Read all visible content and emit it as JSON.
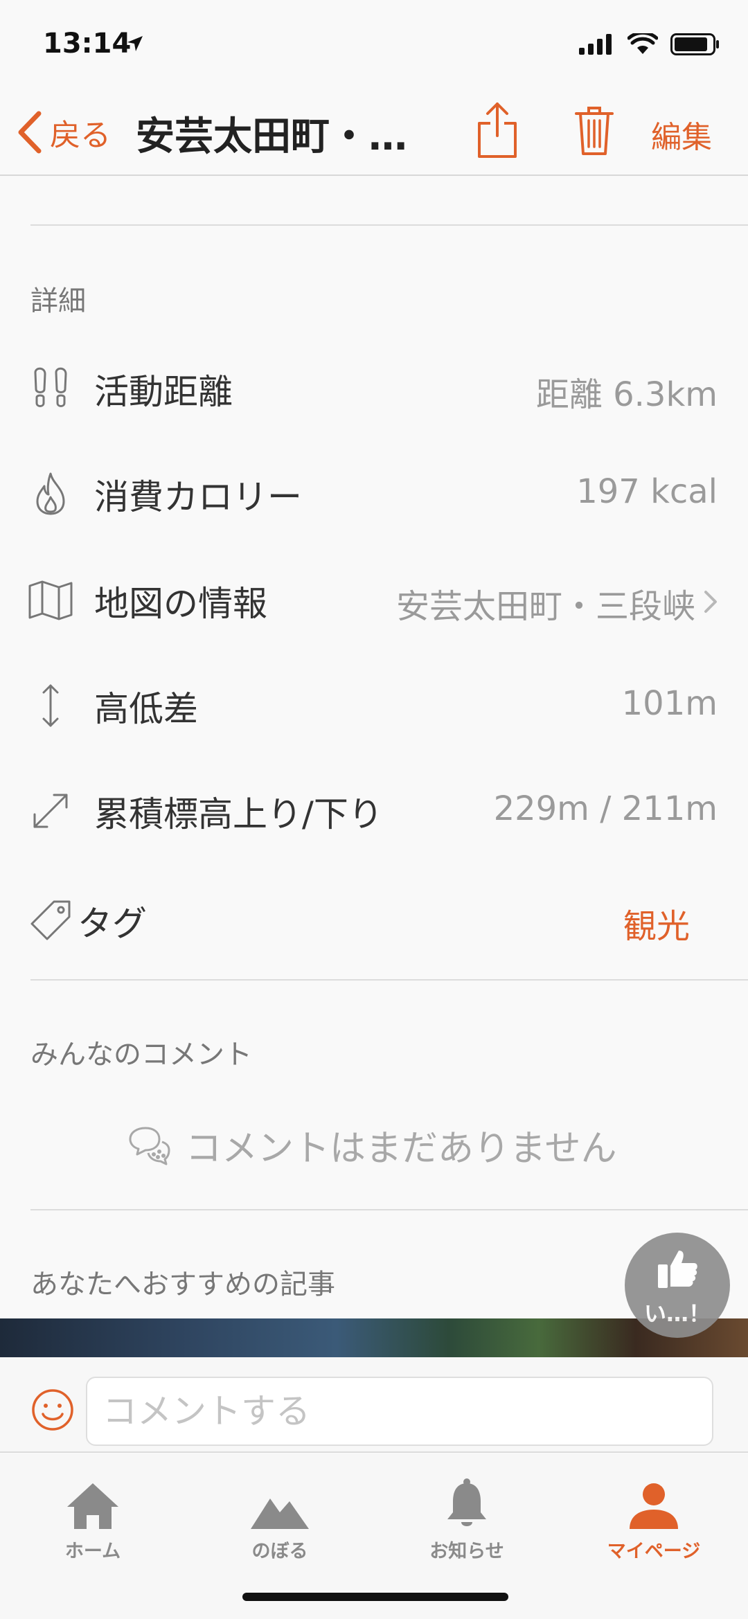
{
  "status_bar": {
    "time": "13:14"
  },
  "nav": {
    "back_label": "戻る",
    "title": "安芸太田町・…",
    "edit_label": "編集"
  },
  "details": {
    "section_title": "詳細",
    "rows": [
      {
        "label": "活動距離",
        "value": "距離 6.3km",
        "icon": "footprints-icon"
      },
      {
        "label": "消費カロリー",
        "value": "197 kcal",
        "icon": "flame-icon"
      },
      {
        "label": "地図の情報",
        "value": "安芸太田町・三段峡",
        "icon": "map-icon"
      },
      {
        "label": "高低差",
        "value": "101m",
        "icon": "vertical-arrows-icon"
      },
      {
        "label": "累積標高上り/下り",
        "value": "229m / 211m",
        "icon": "diagonal-arrows-icon"
      },
      {
        "label": "タグ",
        "value": "観光",
        "icon": "tag-icon"
      }
    ]
  },
  "comments": {
    "section_title": "みんなのコメント",
    "empty_text": "コメントはまだありません"
  },
  "recommend": {
    "section_title": "あなたへおすすめの記事"
  },
  "like_button": {
    "label": "い…！"
  },
  "comment_bar": {
    "placeholder": "コメントする"
  },
  "tabs": [
    {
      "label": "ホーム",
      "icon": "house-icon",
      "active": false
    },
    {
      "label": "のぼる",
      "icon": "mountain-icon",
      "active": false
    },
    {
      "label": "お知らせ",
      "icon": "bell-icon",
      "active": false
    },
    {
      "label": "マイページ",
      "icon": "person-icon",
      "active": true
    }
  ],
  "colors": {
    "accent": "#e0612a",
    "muted": "#9a9a9a",
    "tab_inactive": "#8a8a8a"
  }
}
